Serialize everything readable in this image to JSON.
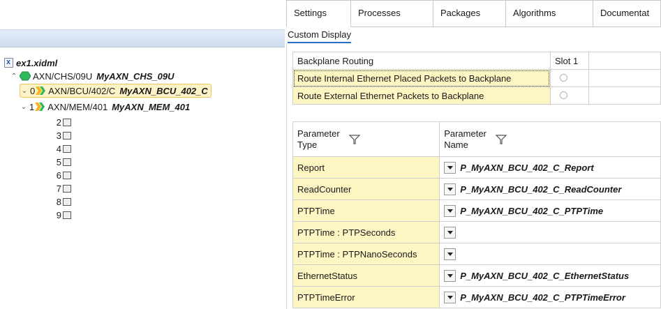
{
  "tree": {
    "root_label": "ex1.xidml",
    "chassis": {
      "path": "AXN/CHS/09U",
      "name": "MyAXN_CHS_09U"
    },
    "modules": [
      {
        "slot": "0",
        "path": "AXN/BCU/402/C",
        "name": "MyAXN_BCU_402_C"
      },
      {
        "slot": "1",
        "path": "AXN/MEM/401",
        "name": "MyAXN_MEM_401"
      }
    ],
    "empty_slots": [
      "2",
      "3",
      "4",
      "5",
      "6",
      "7",
      "8",
      "9"
    ]
  },
  "tabs": [
    "Settings",
    "Processes",
    "Packages",
    "Algorithms",
    "Documentat"
  ],
  "active_tab": "Settings",
  "subtab": "Custom Display",
  "backplane": {
    "header": "Backplane Routing",
    "slot_header": "Slot 1",
    "rows": [
      "Route Internal Ethernet Placed Packets to Backplane",
      "Route External Ethernet Packets to Backplane"
    ]
  },
  "parameters": {
    "col_type": "Parameter Type",
    "col_name": "Parameter Name",
    "rows": [
      {
        "type": "Report",
        "name": "P_MyAXN_BCU_402_C_Report"
      },
      {
        "type": "ReadCounter",
        "name": "P_MyAXN_BCU_402_C_ReadCounter"
      },
      {
        "type": "PTPTime",
        "name": "P_MyAXN_BCU_402_C_PTPTime"
      },
      {
        "type": "PTPTime : PTPSeconds",
        "name": ""
      },
      {
        "type": "PTPTime : PTPNanoSeconds",
        "name": ""
      },
      {
        "type": "EthernetStatus",
        "name": "P_MyAXN_BCU_402_C_EthernetStatus"
      },
      {
        "type": "PTPTimeError",
        "name": "P_MyAXN_BCU_402_C_PTPTimeError"
      }
    ]
  },
  "colors": {
    "accent": "#2b6cc4",
    "row_highlight": "#fdf5c2",
    "chassis_icon": "#2fb85a",
    "module_icon": "#f2b51c"
  }
}
